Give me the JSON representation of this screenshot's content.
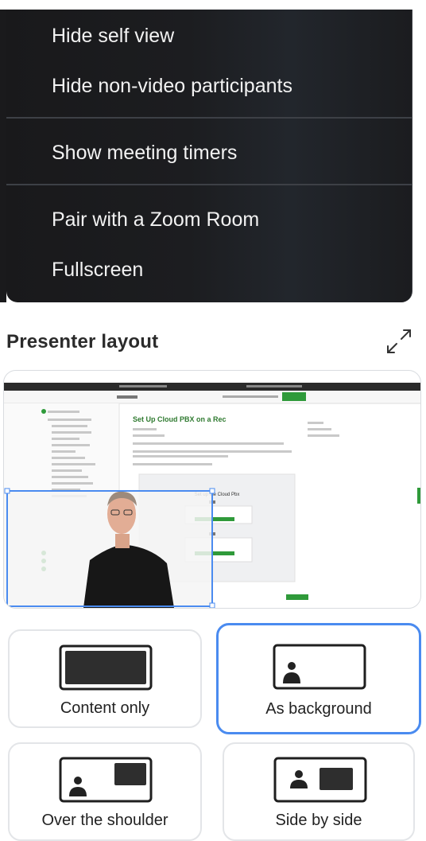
{
  "menu": {
    "items": [
      {
        "label": "Hide self view"
      },
      {
        "label": "Hide non-video participants"
      },
      {
        "label": "Show meeting timers"
      },
      {
        "label": "Pair with a Zoom Room"
      },
      {
        "label": "Fullscreen"
      }
    ]
  },
  "presenter": {
    "title": "Presenter layout",
    "options": [
      {
        "label": "Content only",
        "selected": false,
        "icon": "content-only-icon"
      },
      {
        "label": "As background",
        "selected": true,
        "icon": "as-background-icon"
      },
      {
        "label": "Over the shoulder",
        "selected": false,
        "icon": "over-the-shoulder-icon"
      },
      {
        "label": "Side by side",
        "selected": false,
        "icon": "side-by-side-icon"
      }
    ]
  },
  "preview": {
    "heading": "Set Up Cloud PBX on a Rec",
    "diagram_title": "Set up the Cloud Pbx"
  },
  "colors": {
    "accent": "#4a8bf0",
    "menu_bg": "#1c1d20",
    "menu_text": "#f2f2f2",
    "page_green": "#2f9a3a"
  }
}
